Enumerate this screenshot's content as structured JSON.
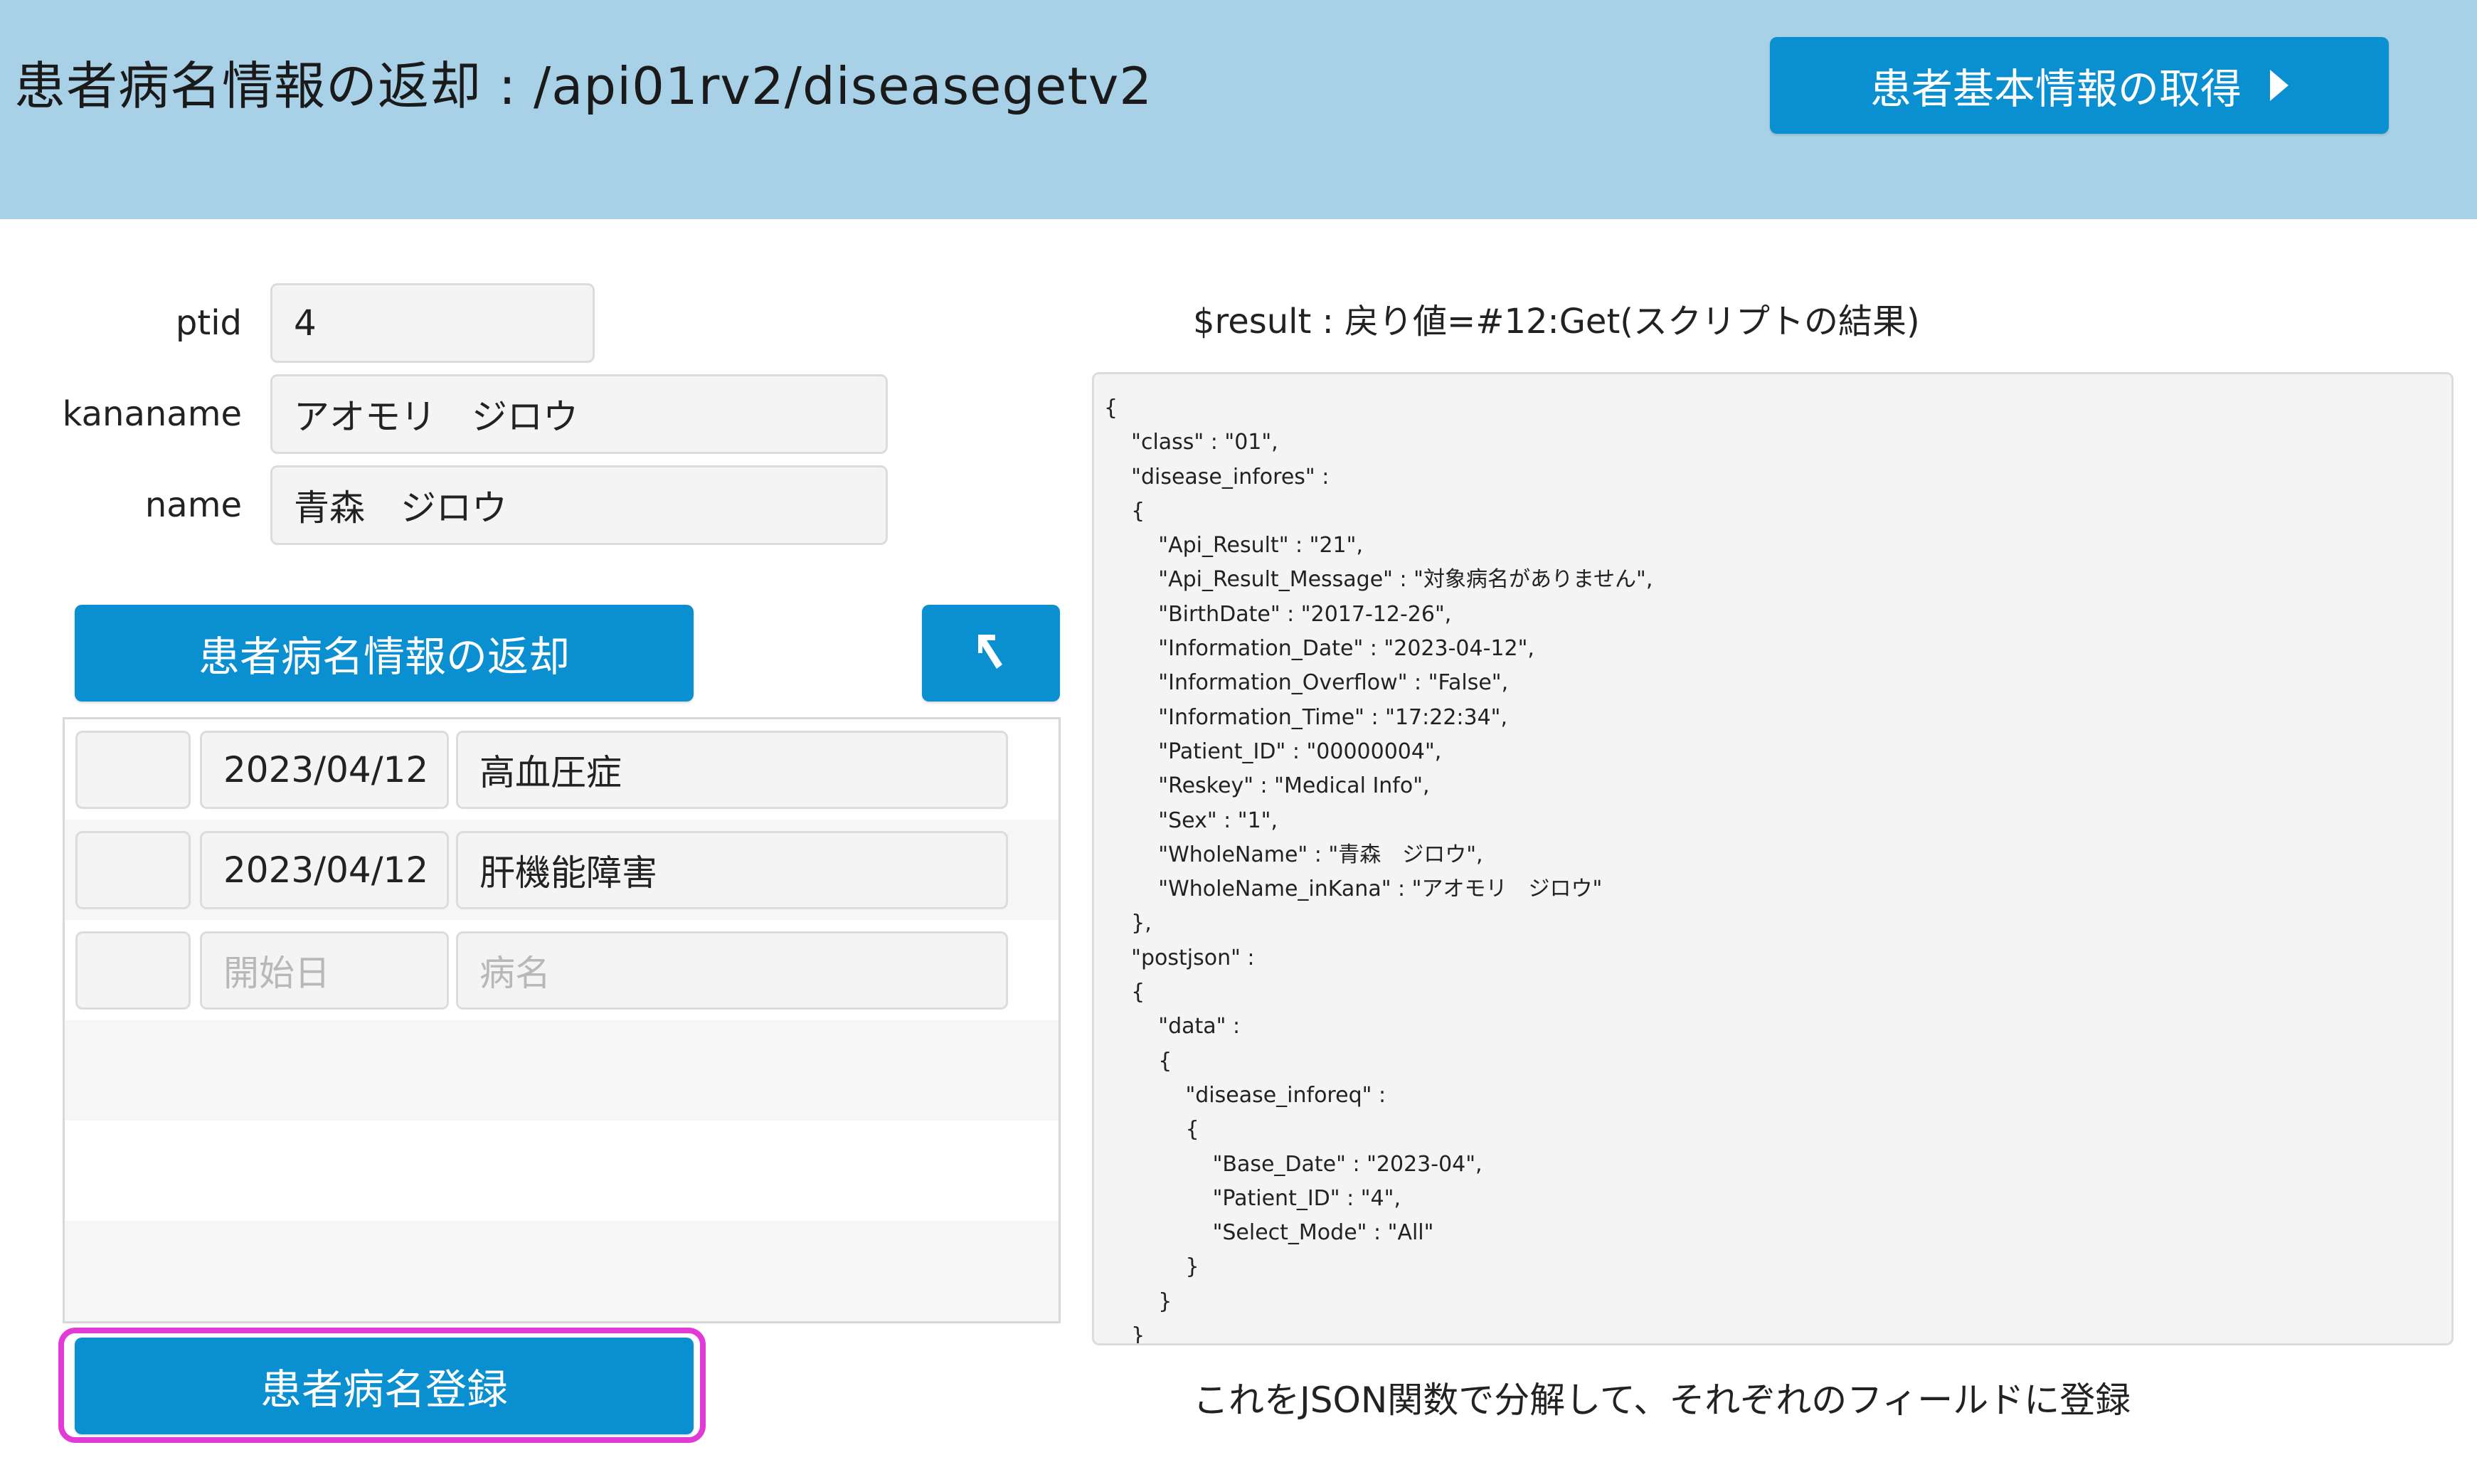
{
  "header": {
    "title": "患者病名情報の返却 : /api01rv2/diseasegetv2",
    "basic_info_button": "患者基本情報の取得"
  },
  "form": {
    "ptid_label": "ptid",
    "ptid_value": "4",
    "kananame_label": "kananame",
    "kananame_value": "アオモリ　ジロウ",
    "name_label": "name",
    "name_value": "青森　ジロウ"
  },
  "buttons": {
    "return_disease": "患者病名情報の返却",
    "back_icon": "↰",
    "register": "患者病名登録"
  },
  "portal": {
    "rows": [
      {
        "check": "",
        "date": "2023/04/12",
        "disease": "高血圧症"
      },
      {
        "check": "",
        "date": "2023/04/12",
        "disease": "肝機能障害"
      }
    ],
    "new_row": {
      "date_placeholder": "開始日",
      "disease_placeholder": "病名"
    }
  },
  "result": {
    "label": "$result : 戻り値=#12:Get(スクリプトの結果)",
    "json_text": "{\n\t\"class\" : \"01\",\n\t\"disease_infores\" :\n\t{\n\t\t\"Api_Result\" : \"21\",\n\t\t\"Api_Result_Message\" : \"対象病名がありません\",\n\t\t\"BirthDate\" : \"2017-12-26\",\n\t\t\"Information_Date\" : \"2023-04-12\",\n\t\t\"Information_Overflow\" : \"False\",\n\t\t\"Information_Time\" : \"17:22:34\",\n\t\t\"Patient_ID\" : \"00000004\",\n\t\t\"Reskey\" : \"Medical Info\",\n\t\t\"Sex\" : \"1\",\n\t\t\"WholeName\" : \"青森　ジロウ\",\n\t\t\"WholeName_inKana\" : \"アオモリ　ジロウ\"\n\t},\n\t\"postjson\" :\n\t{\n\t\t\"data\" :\n\t\t{\n\t\t\t\"disease_inforeq\" :\n\t\t\t{\n\t\t\t\t\"Base_Date\" : \"2023-04\",\n\t\t\t\t\"Patient_ID\" : \"4\",\n\t\t\t\t\"Select_Mode\" : \"All\"\n\t\t\t}\n\t\t}\n\t}"
  },
  "note": "これをJSON関数で分解して、それぞれのフィールドに登録",
  "colors": {
    "header_bg": "#a8d1e7",
    "button_bg": "#0a8fd1",
    "highlight": "#e23ad6"
  }
}
